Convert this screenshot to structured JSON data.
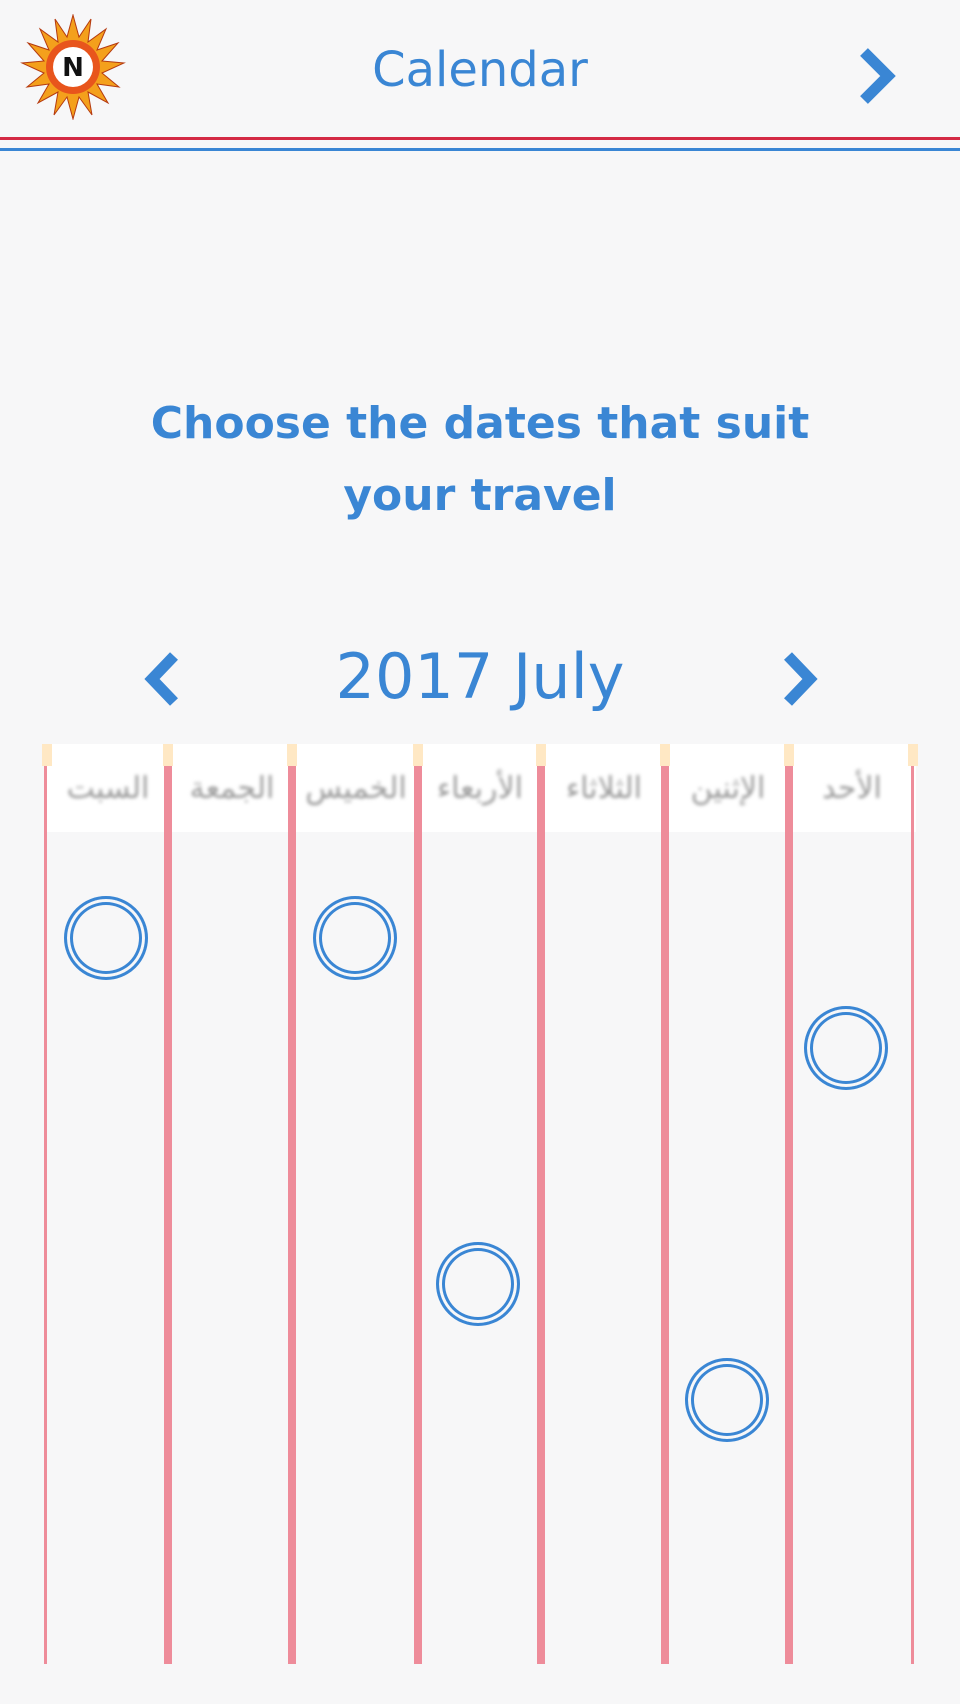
{
  "header": {
    "title": "Calendar",
    "logo_letter": "N",
    "next_icon": "chevron-right-icon"
  },
  "headline": "Choose the dates that suit your travel",
  "calendar": {
    "month_label": "2017 July",
    "prev_icon": "chevron-left-icon",
    "next_icon": "chevron-right-icon",
    "weekdays": [
      "السبت",
      "الجمعة",
      "الخميس",
      "الأربعاء",
      "الثلاثاء",
      "الإثنين",
      "الأحد"
    ]
  },
  "colors": {
    "accent": "#3a86d4",
    "header_rule_red": "#d42a44",
    "column_line": "#ee8c9a",
    "background": "#f7f7f8"
  }
}
